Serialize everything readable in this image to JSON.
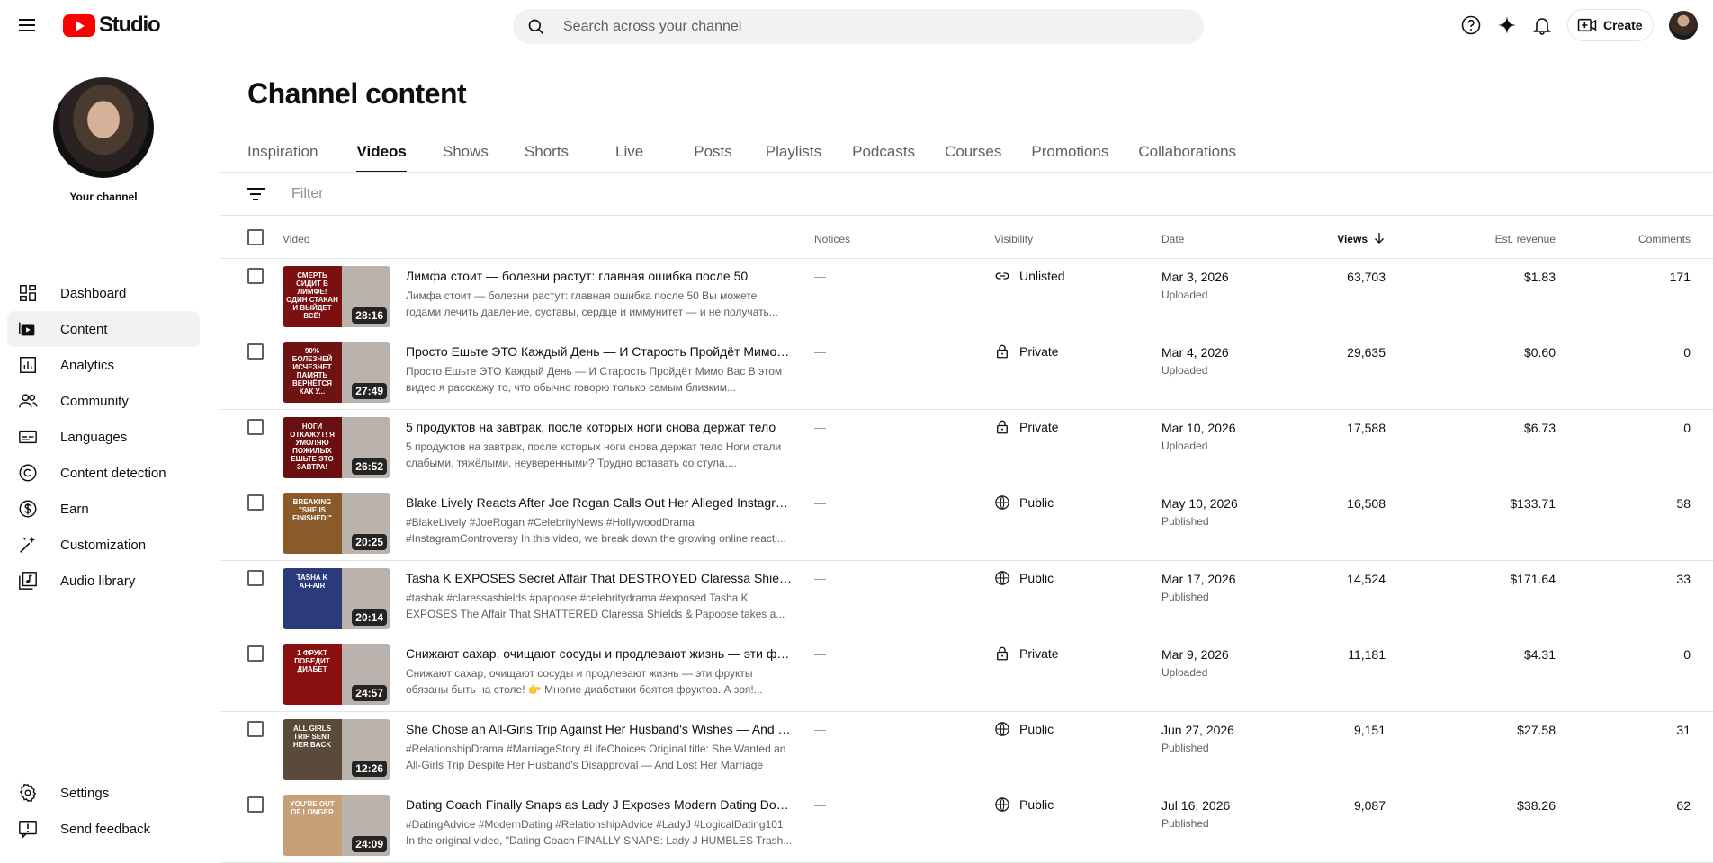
{
  "app": {
    "logo_text": "Studio"
  },
  "search": {
    "placeholder": "Search across your channel"
  },
  "header": {
    "create_label": "Create"
  },
  "sidebar": {
    "channel_label": "Your channel",
    "items": [
      {
        "label": "Dashboard",
        "icon": "dashboard-icon"
      },
      {
        "label": "Content",
        "icon": "content-icon",
        "active": true
      },
      {
        "label": "Analytics",
        "icon": "analytics-icon"
      },
      {
        "label": "Community",
        "icon": "community-icon"
      },
      {
        "label": "Languages",
        "icon": "languages-icon"
      },
      {
        "label": "Content detection",
        "icon": "copyright-icon"
      },
      {
        "label": "Earn",
        "icon": "dollar-icon"
      },
      {
        "label": "Customization",
        "icon": "magic-wand-icon"
      },
      {
        "label": "Audio library",
        "icon": "audio-library-icon"
      }
    ],
    "bottom": [
      {
        "label": "Settings",
        "icon": "gear-icon"
      },
      {
        "label": "Send feedback",
        "icon": "feedback-icon"
      }
    ]
  },
  "main": {
    "title": "Channel content",
    "tabs": [
      "Inspiration",
      "Videos",
      "Shows",
      "Shorts",
      "Live",
      "Posts",
      "Playlists",
      "Podcasts",
      "Courses",
      "Promotions",
      "Collaborations"
    ],
    "active_tab": "Videos",
    "filter_placeholder": "Filter",
    "columns": {
      "video": "Video",
      "notices": "Notices",
      "visibility": "Visibility",
      "date": "Date",
      "views": "Views",
      "revenue": "Est. revenue",
      "comments": "Comments"
    },
    "rows": [
      {
        "title": "Лимфа стоит — болезни растут: главная ошибка после 50",
        "desc": "Лимфа стоит — болезни растут: главная ошибка после 50 Вы можете годами лечить давление, суставы, сердце и иммунитет — и не получать...",
        "duration": "28:16",
        "thumb_text": "Смерть сидит в лимфе! Один стакан и выйдет всё!",
        "notice": "—",
        "visibility": "Unlisted",
        "date": "Mar 3, 2026",
        "status": "Uploaded",
        "views": "63,703",
        "revenue": "$1.83",
        "comments": "171",
        "thumb_color": "#7a1010"
      },
      {
        "title": "Просто Ешьте ЭТО Каждый День — И Старость Пройдёт Мимо Вас",
        "desc": "Просто Ешьте ЭТО Каждый День — И Старость Пройдёт Мимо Вас В этом видео я расскажу то, что обычно говорю только самым близким...",
        "duration": "27:49",
        "thumb_text": "90% болезней исчезнет память вернётся как у...",
        "notice": "—",
        "visibility": "Private",
        "date": "Mar 4, 2026",
        "status": "Uploaded",
        "views": "29,635",
        "revenue": "$0.60",
        "comments": "0",
        "thumb_color": "#6e1212"
      },
      {
        "title": "5 продуктов на завтрак, после которых ноги снова держат тело",
        "desc": "5 продуктов на завтрак, после которых ноги снова держат тело Ноги стали слабыми, тяжёлыми, неуверенными? Трудно вставать со стула,...",
        "duration": "26:52",
        "thumb_text": "Ноги откажут! Я умоляю пожилых ешьте это завтра!",
        "notice": "—",
        "visibility": "Private",
        "date": "Mar 10, 2026",
        "status": "Uploaded",
        "views": "17,588",
        "revenue": "$6.73",
        "comments": "0",
        "thumb_color": "#6a0f0f"
      },
      {
        "title": "Blake Lively Reacts After Joe Rogan Calls Out Her Alleged Instagram Controversy",
        "desc": "#BlakeLively #JoeRogan #CelebrityNews #HollywoodDrama #InstagramControversy In this video, we break down the growing online reacti...",
        "duration": "20:25",
        "thumb_text": "Breaking \"She is finished!\"",
        "notice": "—",
        "visibility": "Public",
        "date": "May 10, 2026",
        "status": "Published",
        "views": "16,508",
        "revenue": "$133.71",
        "comments": "58",
        "thumb_color": "#8a5a2a"
      },
      {
        "title": "Tasha K EXPOSES Secret Affair That DESTROYED Claressa Shields & Papoose",
        "desc": "#tashak #claressashields #papoose #celebritydrama #exposed Tasha K EXPOSES The Affair That SHATTERED Claressa Shields & Papoose takes a...",
        "duration": "20:14",
        "thumb_text": "Tasha K affair",
        "notice": "—",
        "visibility": "Public",
        "date": "Mar 17, 2026",
        "status": "Published",
        "views": "14,524",
        "revenue": "$171.64",
        "comments": "33",
        "thumb_color": "#2a3a7a"
      },
      {
        "title": "Снижают сахар, очищают сосуды и продлевают жизнь — эти фрукты",
        "desc": "Снижают сахар, очищают сосуды и продлевают жизнь — эти фрукты обязаны быть на столе! 👉 Многие диабетики боятся фруктов. А зря!...",
        "duration": "24:57",
        "thumb_text": "1 фрукт победит диабет",
        "notice": "—",
        "visibility": "Private",
        "date": "Mar 9, 2026",
        "status": "Uploaded",
        "views": "11,181",
        "revenue": "$4.31",
        "comments": "0",
        "thumb_color": "#8a1010"
      },
      {
        "title": "She Chose an All-Girls Trip Against Her Husband's Wishes — And It Cost Her",
        "desc": "#RelationshipDrama #MarriageStory #LifeChoices Original title: She Wanted an All-Girls Trip Despite Her Husband's Disapproval — And Lost Her Marriage Wha...",
        "duration": "12:26",
        "thumb_text": "All girls trip sent her back",
        "notice": "—",
        "visibility": "Public",
        "date": "Jun 27, 2026",
        "status": "Published",
        "views": "9,151",
        "revenue": "$27.58",
        "comments": "31",
        "thumb_color": "#5a4a3a"
      },
      {
        "title": "Dating Coach Finally Snaps as Lady J Exposes Modern Dating Double Standards",
        "desc": "#DatingAdvice #ModernDating #RelationshipAdvice #LadyJ #LogicalDating101 In the original video, \"Dating Coach FINALLY SNAPS: Lady J HUMBLES Trash...",
        "duration": "24:09",
        "thumb_text": "You're out of longer",
        "notice": "—",
        "visibility": "Public",
        "date": "Jul 16, 2026",
        "status": "Published",
        "views": "9,087",
        "revenue": "$38.26",
        "comments": "62",
        "thumb_color": "#c8a078"
      }
    ]
  }
}
